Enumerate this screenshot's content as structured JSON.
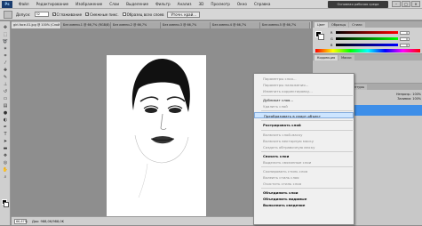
{
  "menubar": {
    "logo": "Ps",
    "items": [
      "Файл",
      "Редактирование",
      "Изображение",
      "Слои",
      "Выделение",
      "Фильтр",
      "Анализ",
      "3D",
      "Просмотр",
      "Окно",
      "Справка"
    ],
    "zoom": "100%",
    "workspace": "Основная рабочая среда",
    "window_controls": [
      "–",
      "□",
      "×"
    ]
  },
  "options": {
    "feather_label": "Допуск:",
    "feather_value": "32",
    "antialias": "Сглаживание",
    "contiguous": "Смежные пикс.",
    "sample_all": "Образец всех слоев",
    "refine": "Уточн. край..."
  },
  "tabs": [
    "girl-face-01.jpg @ 100% (Слой 0, RGB/8)",
    "Без имени-1 @ 66,7% (RGB/8)",
    "Без имени-2 @ 66,7%",
    "Без имени-3 @ 66,7%",
    "Без имени-4 @ 66,7%",
    "Без имени-5 @ 66,7%"
  ],
  "status": {
    "zoom": "66,67%",
    "doc": "Док: 988,0K/988,0K"
  },
  "panels": {
    "color_tabs": [
      "Цвет",
      "Образцы",
      "Стили"
    ],
    "channels": [
      {
        "label": "R",
        "value": "0",
        "grad": "linear-gradient(to right, #000, #f00)"
      },
      {
        "label": "G",
        "value": "0",
        "grad": "linear-gradient(to right, #000, #0f0)"
      },
      {
        "label": "B",
        "value": "0",
        "grad": "linear-gradient(to right, #000, #00f)"
      }
    ],
    "adjust_tabs": [
      "Коррекция",
      "Маски"
    ],
    "layers_tabs": [
      "Слои",
      "Каналы",
      "Контуры"
    ],
    "layers_opacity": "Непрозр.: 100%",
    "layers_fill": "Заливка: 100%"
  },
  "context_menu": {
    "items": [
      {
        "label": "Параметры слоя...",
        "state": "disabled"
      },
      {
        "label": "Параметры наложения...",
        "state": "disabled"
      },
      {
        "label": "Изменить корректировку...",
        "state": "disabled"
      },
      {
        "sep": true
      },
      {
        "label": "Дубликат слоя...",
        "state": "normal"
      },
      {
        "label": "Удалить слой",
        "state": "disabled"
      },
      {
        "sep": true
      },
      {
        "label": "Преобразовать в смарт-объект",
        "state": "highlight"
      },
      {
        "sep": true
      },
      {
        "label": "Растрировать слой",
        "state": "bold"
      },
      {
        "sep": true
      },
      {
        "label": "Включить слой-маску",
        "state": "disabled"
      },
      {
        "label": "Включить векторную маску",
        "state": "disabled"
      },
      {
        "label": "Создать обтравочную маску",
        "state": "disabled"
      },
      {
        "sep": true
      },
      {
        "label": "Связать слои",
        "state": "bold"
      },
      {
        "label": "Выделить связанные слои",
        "state": "disabled"
      },
      {
        "sep": true
      },
      {
        "label": "Скопировать стиль слоя",
        "state": "disabled"
      },
      {
        "label": "Вклеить стиль слоя",
        "state": "disabled"
      },
      {
        "label": "Очистить стиль слоя",
        "state": "disabled"
      },
      {
        "sep": true
      },
      {
        "label": "Объединить слои",
        "state": "bold"
      },
      {
        "label": "Объединить видимые",
        "state": "bold"
      },
      {
        "label": "Выполнить сведение",
        "state": "bold"
      }
    ]
  }
}
